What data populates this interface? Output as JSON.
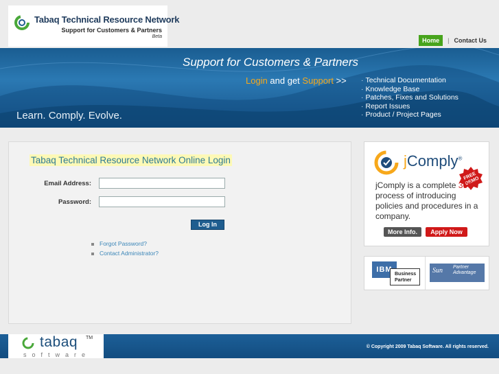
{
  "header": {
    "logo_title": "Tabaq Technical Resource Network",
    "logo_subtitle": "Support for Customers & Partners",
    "logo_beta": "Beta",
    "nav": {
      "home": "Home",
      "separator": "|",
      "contact": "Contact Us"
    }
  },
  "banner": {
    "headline": "Support for Customers & Partners",
    "cta_login": "Login",
    "cta_middle": " and get ",
    "cta_support": "Support",
    "cta_arrow": "  >>",
    "links": [
      "Technical Documentation",
      "Knowledge Base",
      "Patches, Fixes and Solutions",
      "Report Issues",
      "Product / Project Pages"
    ],
    "tagline": "Learn. Comply. Evolve."
  },
  "login": {
    "title": "Tabaq Technical Resource Network Online Login",
    "email_label": "Email Address:",
    "email_value": "",
    "password_label": "Password:",
    "password_value": "",
    "button": "Log In",
    "links": [
      "Forgot Password?",
      "Contact Administrator?"
    ]
  },
  "ad": {
    "title_j": "j",
    "title_rest": "Comply",
    "reg": "®",
    "badge_line1": "FREE",
    "badge_line2": "DEMO",
    "desc_before": "jComply is a complete ",
    "desc_highlight": "360",
    "desc_after": " process of introducing policies and procedures in a company.",
    "more_button": "More Info.",
    "apply_button": "Apply Now"
  },
  "partners": {
    "ibm_logo": "IBM",
    "ibm_line1": "Business",
    "ibm_line2": "Partner",
    "sun_logo": "Sun",
    "sun_line1": "Partner",
    "sun_line2": "Advantage"
  },
  "footer": {
    "logo_word": "tabaq",
    "logo_tm": "TM",
    "logo_sub": "software",
    "copyright": "© Copyright 2009 Tabaq Software. All rights reserved."
  },
  "colors": {
    "brand_blue": "#1f5d8f",
    "accent_orange": "#f7a81b",
    "nav_green": "#47a41c",
    "cta_red": "#d01919"
  }
}
